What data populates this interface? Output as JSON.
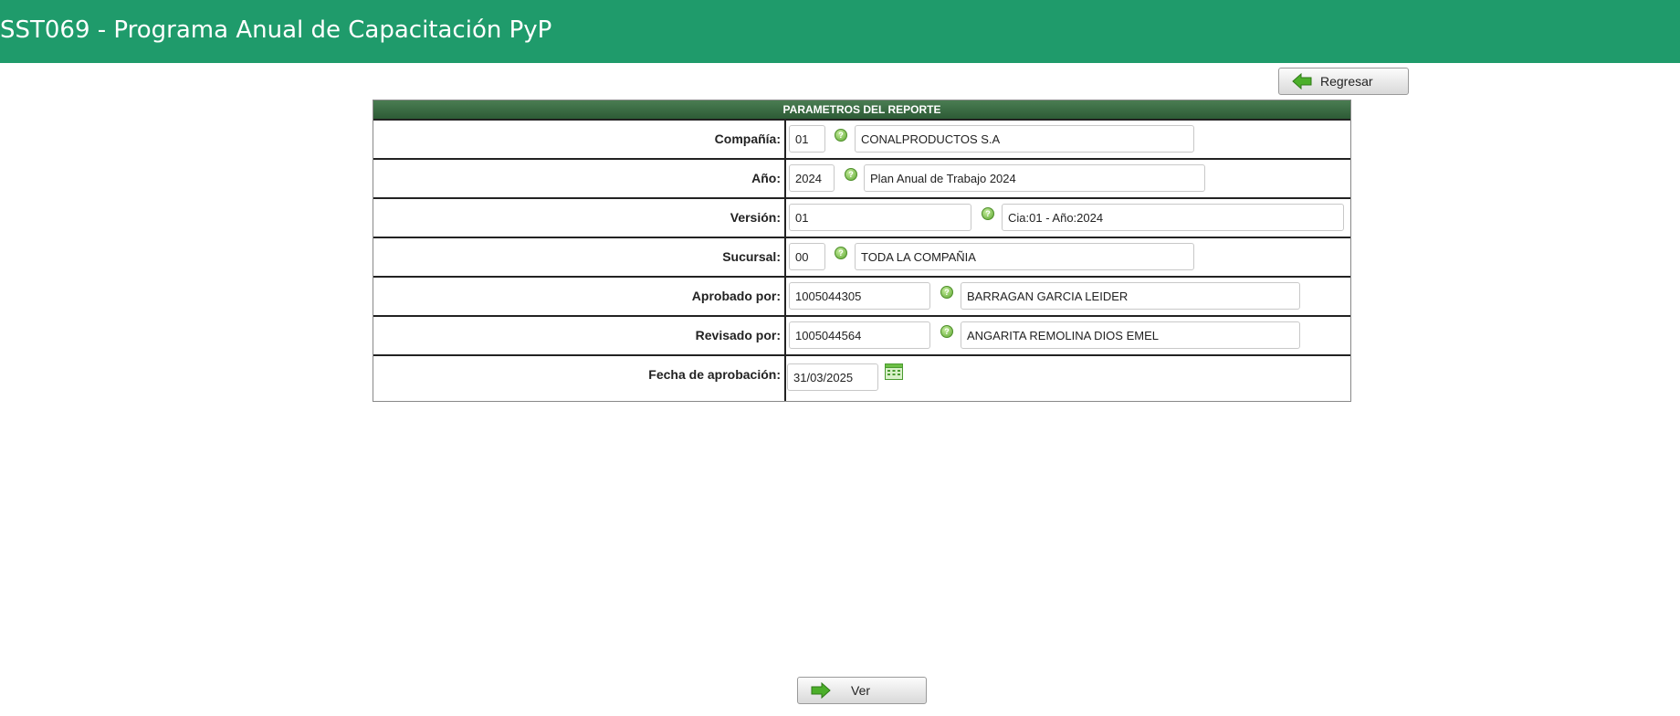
{
  "header": {
    "title": "SST069 - Programa Anual de Capacitación PyP"
  },
  "toolbar": {
    "back_label": "Regresar",
    "view_label": "Ver"
  },
  "report": {
    "heading": "PARAMETROS DEL REPORTE",
    "rows": [
      {
        "label": "Compañía:",
        "code": "01",
        "description": "CONALPRODUCTOS S.A"
      },
      {
        "label": "Año:",
        "code": "2024",
        "description": "Plan Anual de Trabajo 2024"
      },
      {
        "label": "Versión:",
        "code": "01",
        "description": "Cia:01  - Año:2024"
      },
      {
        "label": "Sucursal:",
        "code": "00",
        "description": "TODA LA COMPAÑIA"
      },
      {
        "label": "Aprobado por:",
        "code": "1005044305",
        "description": "BARRAGAN GARCIA LEIDER"
      },
      {
        "label": "Revisado por:",
        "code": "1005044564",
        "description": "ANGARITA REMOLINA  DIOS  EMEL"
      },
      {
        "label": "Fecha de aprobación:",
        "date": "31/03/2025"
      }
    ]
  },
  "icons": {
    "back": "arrow-left-icon",
    "view": "arrow-right-icon",
    "help": "help-icon",
    "calendar": "calendar-icon"
  },
  "colors": {
    "title_bar": "#1f9b6b",
    "report_header": "#3a6a44",
    "arrow": "#4caf2a"
  }
}
